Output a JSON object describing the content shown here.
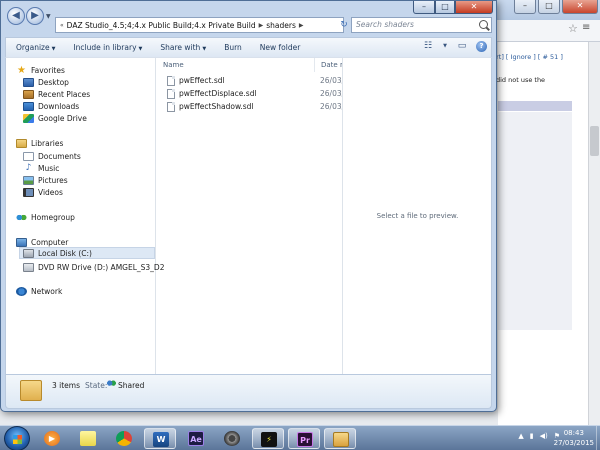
{
  "background_page": {
    "links": "port]  [ Ignore ]  [ # 51 ]",
    "text": "I did not use the"
  },
  "explorer": {
    "address_crumbs": [
      "DAZ Studio_4.5;4;4.x Public Build;4.x Private Build",
      "shaders"
    ],
    "search_placeholder": "Search shaders",
    "commands": [
      "Organize",
      "Include in library",
      "Share with",
      "Burn",
      "New folder"
    ],
    "nav": {
      "favorites": "Favorites",
      "favorite_items": [
        "Desktop",
        "Recent Places",
        "Downloads",
        "Google Drive"
      ],
      "libraries": "Libraries",
      "library_items": [
        "Documents",
        "Music",
        "Pictures",
        "Videos"
      ],
      "homegroup": "Homegroup",
      "computer": "Computer",
      "computer_items": [
        "Local Disk (C:)",
        "DVD RW Drive (D:) AMGEL_S3_D2"
      ],
      "network": "Network"
    },
    "columns": {
      "name": "Name",
      "date": "Date m"
    },
    "files": [
      {
        "name": "pwEffect.sdl",
        "date": "26/03/"
      },
      {
        "name": "pwEffectDisplace.sdl",
        "date": "26/03/"
      },
      {
        "name": "pwEffectShadow.sdl",
        "date": "26/03/"
      }
    ],
    "preview_message": "Select a file to preview.",
    "details": {
      "count": "3 items",
      "state_label": "State:",
      "state_value": "Shared"
    }
  },
  "taskbar": {
    "apps": [
      "media-player",
      "sticky-notes",
      "chrome",
      "word",
      "after-effects",
      "disk-tool",
      "tool",
      "premiere",
      "explorer"
    ],
    "time": "08:43",
    "date": "27/03/2015"
  },
  "colors": {
    "title_glass": "#c5d6ec",
    "taskbar": "#5b7599",
    "selection": "#dde8f5"
  }
}
